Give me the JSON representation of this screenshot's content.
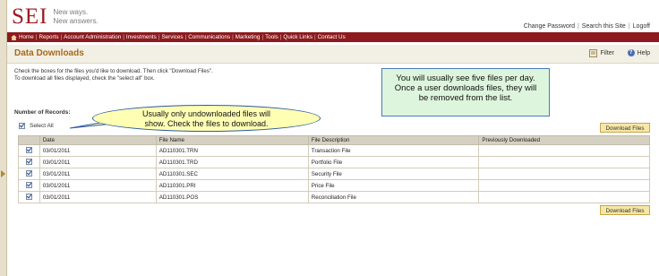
{
  "brand": {
    "name": "SEI",
    "tagline_line1": "New ways.",
    "tagline_line2": "New answers."
  },
  "util_links": [
    "Change Password",
    "Search this Site",
    "Logoff"
  ],
  "nav": {
    "items": [
      "Home",
      "Reports",
      "Account Administration",
      "Investments",
      "Services",
      "Communications",
      "Marketing",
      "Tools",
      "Quick Links",
      "Contact Us"
    ]
  },
  "page": {
    "title": "Data Downloads",
    "filter_label": "Filter",
    "help_label": "Help",
    "instructions_line1": "Check the boxes for the files you'd like to download. Then click \"Download Files\".",
    "instructions_line2": "To download all files displayed, check the \"select all\" box.",
    "num_records_label": "Number of Records:",
    "select_all_label": "Select All",
    "download_button": "Download Files"
  },
  "table": {
    "columns": [
      "",
      "Date",
      "File Name",
      "File Description",
      "Previously Downloaded"
    ],
    "rows": [
      {
        "date": "03/01/2011",
        "file": "AD110301.TRN",
        "desc": "Transaction File",
        "prev": ""
      },
      {
        "date": "03/01/2011",
        "file": "AD110301.TRD",
        "desc": "Portfolio File",
        "prev": ""
      },
      {
        "date": "03/01/2011",
        "file": "AD110301.SEC",
        "desc": "Security File",
        "prev": ""
      },
      {
        "date": "03/01/2011",
        "file": "AD110301.PRI",
        "desc": "Price File",
        "prev": ""
      },
      {
        "date": "03/01/2011",
        "file": "AD110301.POS",
        "desc": "Reconciliation File",
        "prev": ""
      }
    ]
  },
  "callouts": {
    "green_line1": "You will usually see five files per day.",
    "green_line2": "Once a user downloads files, they will",
    "green_line3": "be removed from the list.",
    "yellow_line1": "Usually only undownloaded files will",
    "yellow_line2": "show.  Check the files to download."
  },
  "colors": {
    "brand": "#9e1b20",
    "nav_bg": "#8c1a1e",
    "title_color": "#a86a1a",
    "button_bg": "#f7e7a6",
    "green_callout": "#ddf5dc",
    "yellow_callout": "#ffffb4"
  }
}
